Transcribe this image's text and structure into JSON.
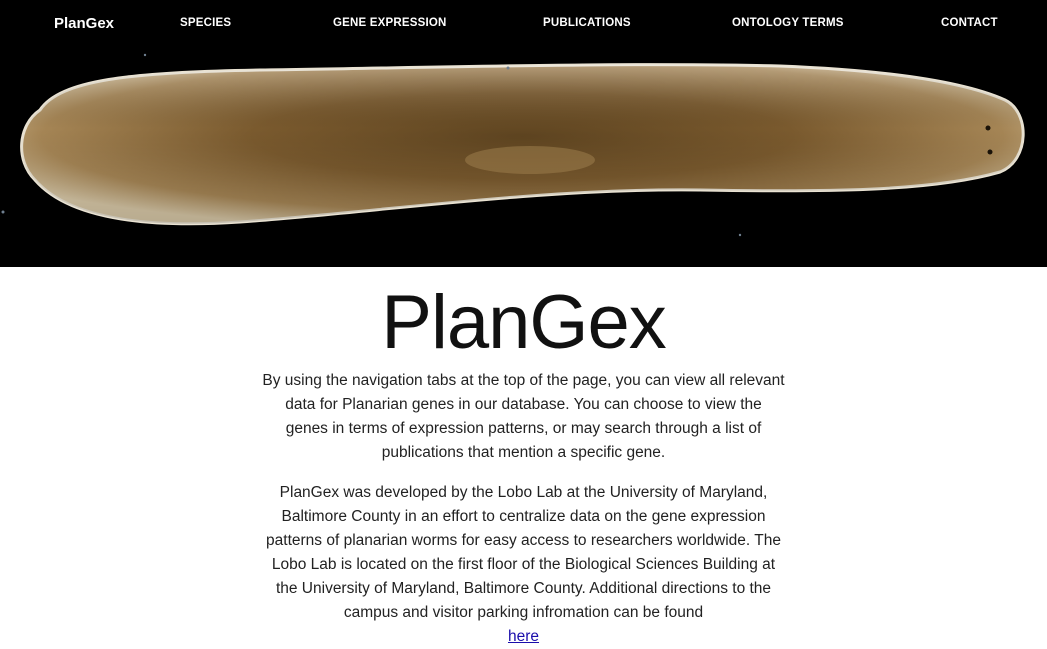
{
  "navbar": {
    "brand": "PlanGex",
    "items": [
      {
        "label": "SPECIES"
      },
      {
        "label": "GENE EXPRESSION"
      },
      {
        "label": "PUBLICATIONS"
      },
      {
        "label": "ONTOLOGY TERMS"
      },
      {
        "label": "CONTACT"
      }
    ]
  },
  "main": {
    "title": "PlanGex",
    "paragraph_1": "By using the navigation tabs at the top of the page, you can view all relevant data for Planarian genes in our database. You can choose to view the genes in terms of expression patterns, or may search through a list of publications that mention a specific gene.",
    "paragraph_2": "PlanGex was developed by the Lobo Lab at the University of Maryland, Baltimore County in an effort to centralize data on the gene expression patterns of planarian worms for easy access to researchers worldwide. The Lobo Lab is located on the first floor of the Biological Sciences Building at the University of Maryland, Baltimore County. Additional directions to the campus and visitor parking infromation can be found",
    "link_here": "here"
  },
  "colors": {
    "hero_background": "#000000",
    "link": "#1a0dab",
    "worm_body": "#7a5a2e"
  },
  "icons": {
    "hero_image": "planarian-worm-image"
  }
}
